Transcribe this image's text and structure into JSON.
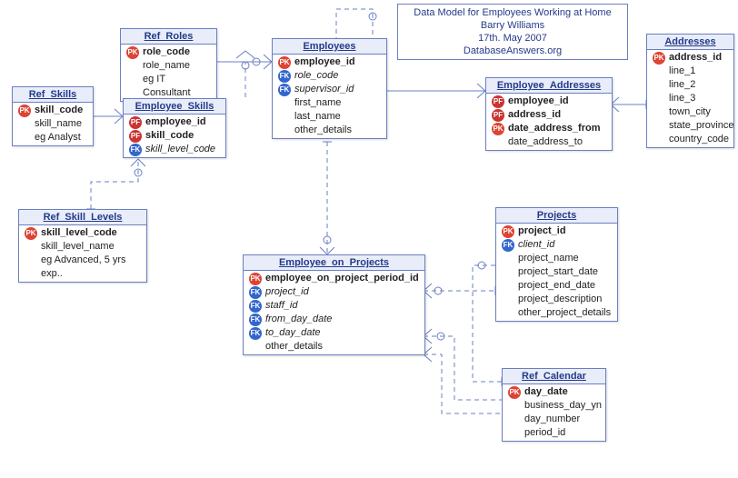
{
  "title_box": {
    "line1": "Data Model for Employees Working at Home",
    "line2": "Barry Williams",
    "line3": "17th. May 2007",
    "line4": "DatabaseAnswers.org"
  },
  "entities": {
    "ref_roles": {
      "name": "Ref_Roles",
      "attrs": [
        {
          "key": "pk",
          "label": "role_code",
          "bold": true
        },
        {
          "key": "",
          "label": "role_name"
        },
        {
          "key": "",
          "label": "eg IT Consultant"
        }
      ]
    },
    "ref_skills": {
      "name": "Ref_Skills",
      "attrs": [
        {
          "key": "pk",
          "label": "skill_code",
          "bold": true
        },
        {
          "key": "",
          "label": "skill_name"
        },
        {
          "key": "",
          "label": "eg Analyst"
        }
      ]
    },
    "employee_skills": {
      "name": "Employee_Skills",
      "attrs": [
        {
          "key": "pf",
          "label": "employee_id",
          "bold": true
        },
        {
          "key": "pf",
          "label": "skill_code",
          "bold": true
        },
        {
          "key": "fk",
          "label": "skill_level_code",
          "italic": true
        }
      ]
    },
    "ref_skill_levels": {
      "name": "Ref_Skill_Levels",
      "attrs": [
        {
          "key": "pk",
          "label": "skill_level_code",
          "bold": true
        },
        {
          "key": "",
          "label": "skill_level_name"
        },
        {
          "key": "",
          "label": "eg Advanced, 5 yrs exp.."
        }
      ]
    },
    "employees": {
      "name": "Employees",
      "attrs": [
        {
          "key": "pk",
          "label": "employee_id",
          "bold": true
        },
        {
          "key": "fk",
          "label": "role_code",
          "italic": true
        },
        {
          "key": "fk",
          "label": "supervisor_id",
          "italic": true
        },
        {
          "key": "",
          "label": "first_name"
        },
        {
          "key": "",
          "label": "last_name"
        },
        {
          "key": "",
          "label": "other_details"
        }
      ]
    },
    "employee_addresses": {
      "name": "Employee_Addresses",
      "attrs": [
        {
          "key": "pf",
          "label": "employee_id",
          "bold": true
        },
        {
          "key": "pf",
          "label": "address_id",
          "bold": true
        },
        {
          "key": "pk",
          "label": "date_address_from",
          "bold": true
        },
        {
          "key": "",
          "label": "date_address_to"
        }
      ]
    },
    "addresses": {
      "name": "Addresses",
      "attrs": [
        {
          "key": "pk",
          "label": "address_id",
          "bold": true
        },
        {
          "key": "",
          "label": "line_1"
        },
        {
          "key": "",
          "label": "line_2"
        },
        {
          "key": "",
          "label": "line_3"
        },
        {
          "key": "",
          "label": "town_city"
        },
        {
          "key": "",
          "label": "state_province"
        },
        {
          "key": "",
          "label": "country_code"
        }
      ]
    },
    "employee_on_projects": {
      "name": "Employee_on_Projects",
      "attrs": [
        {
          "key": "pk",
          "label": "employee_on_project_period_id",
          "bold": true
        },
        {
          "key": "fk",
          "label": "project_id",
          "italic": true
        },
        {
          "key": "fk",
          "label": "staff_id",
          "italic": true
        },
        {
          "key": "fk",
          "label": "from_day_date",
          "italic": true
        },
        {
          "key": "fk",
          "label": "to_day_date",
          "italic": true
        },
        {
          "key": "",
          "label": "other_details"
        }
      ]
    },
    "projects": {
      "name": "Projects",
      "attrs": [
        {
          "key": "pk",
          "label": "project_id",
          "bold": true
        },
        {
          "key": "fk",
          "label": "client_id",
          "italic": true
        },
        {
          "key": "",
          "label": "project_name"
        },
        {
          "key": "",
          "label": "project_start_date"
        },
        {
          "key": "",
          "label": "project_end_date"
        },
        {
          "key": "",
          "label": "project_description"
        },
        {
          "key": "",
          "label": "other_project_details"
        }
      ]
    },
    "ref_calendar": {
      "name": "Ref_Calendar",
      "attrs": [
        {
          "key": "pk",
          "label": "day_date",
          "bold": true
        },
        {
          "key": "",
          "label": "business_day_yn"
        },
        {
          "key": "",
          "label": "day_number"
        },
        {
          "key": "",
          "label": "period_id"
        }
      ]
    }
  }
}
